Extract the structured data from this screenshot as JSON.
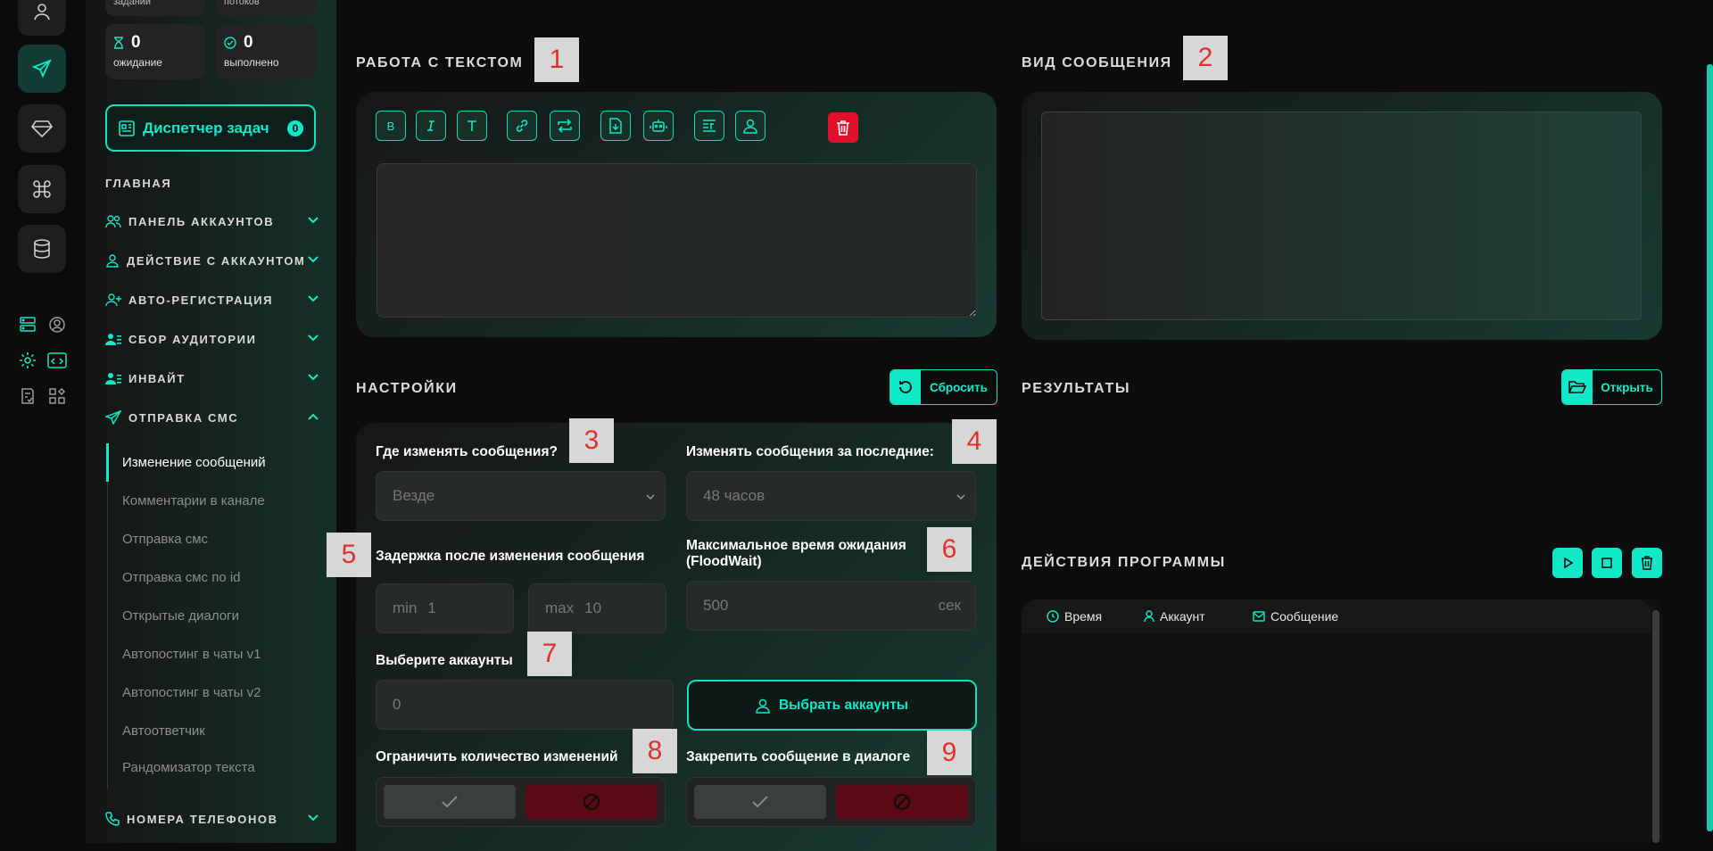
{
  "sidebar_stats": {
    "top_left_label": "заданий",
    "top_right_label": "потоков",
    "waiting_count": "0",
    "waiting_label": "ожидание",
    "done_count": "0",
    "done_label": "выполнено"
  },
  "dispatcher": {
    "label": "Диспетчер задач",
    "count": "0"
  },
  "nav": {
    "home": "ГЛАВНАЯ",
    "sections": [
      {
        "label": "ПАНЕЛЬ АККАУНТОВ",
        "icon": "users-icon"
      },
      {
        "label": "ДЕЙСТВИЕ С АККАУНТОМ",
        "icon": "user-icon"
      },
      {
        "label": "АВТО-РЕГИСТРАЦИЯ",
        "icon": "user-plus-icon"
      },
      {
        "label": "СБОР АУДИТОРИИ",
        "icon": "user-list-icon"
      },
      {
        "label": "ИНВАЙТ",
        "icon": "user-list-icon"
      },
      {
        "label": "ОТПРАВКА СМС",
        "icon": "send-icon"
      },
      {
        "label": "НОМЕРА ТЕЛЕФОНОВ",
        "icon": "phone-icon"
      }
    ],
    "sms_items": [
      "Изменение сообщений",
      "Комментарии в канале",
      "Отправка смс",
      "Отправка смс по id",
      "Открытые диалоги",
      "Автопостинг в чаты v1",
      "Автопостинг в чаты v2",
      "Автоответчик",
      "Рандомизатор текста"
    ]
  },
  "text_work": {
    "title": "РАБОТА С ТЕКСТОМ",
    "editor_value": ""
  },
  "preview": {
    "title": "ВИД СООБЩЕНИЯ"
  },
  "settings": {
    "title": "НАСТРОЙКИ",
    "reset_label": "Сбросить",
    "where_label": "Где изменять сообщения?",
    "where_value": "Везде",
    "period_label": "Изменять сообщения за последние:",
    "period_value": "48 часов",
    "delay_label": "Задержка после изменения сообщения",
    "delay_min_prefix": "min",
    "delay_min_value": "1",
    "delay_max_prefix": "max",
    "delay_max_value": "10",
    "floodwait_label": "Максимальное время ожидания (FloodWait)",
    "floodwait_value": "500",
    "floodwait_unit": "сек",
    "accounts_label": "Выберите аккаунты",
    "accounts_value": "0",
    "choose_accounts_label": "Выбрать аккаунты",
    "limit_label": "Ограничить количество изменений",
    "pin_label": "Закрепить сообщение в диалоге"
  },
  "results": {
    "title": "РЕЗУЛЬТАТЫ",
    "open_label": "Открыть"
  },
  "actions": {
    "title": "ДЕЙСТВИЯ ПРОГРАММЫ",
    "col_time": "Время",
    "col_account": "Аккаунт",
    "col_message": "Сообщение"
  },
  "markers": [
    "1",
    "2",
    "3",
    "4",
    "5",
    "6",
    "7",
    "8",
    "9"
  ],
  "colors": {
    "accent": "#10e8c8",
    "danger": "#e0102a",
    "deny": "#5a0a14"
  }
}
